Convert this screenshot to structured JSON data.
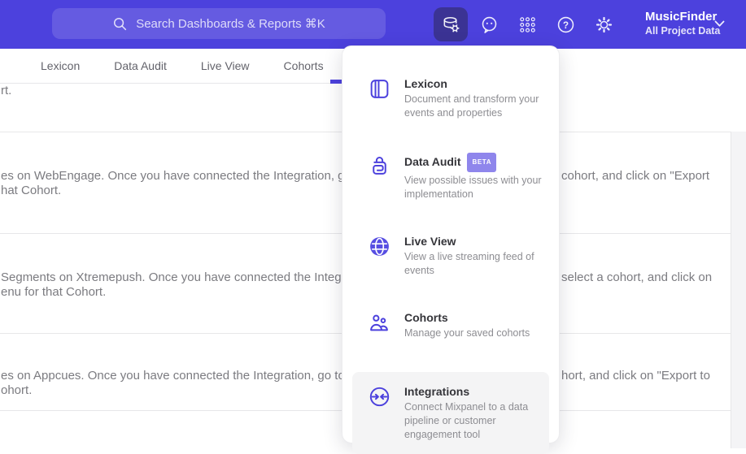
{
  "colors": {
    "topbar_bg": "#4c41dd",
    "accent": "#4c41dd",
    "beta_badge_bg": "#8f86ec",
    "hover_item_bg": "#f4f4f5"
  },
  "topbar": {
    "search_placeholder": "Search Dashboards & Reports ⌘K",
    "icons": [
      "data-management-icon",
      "feedback-smiley-icon",
      "apps-grid-icon",
      "help-icon",
      "settings-gear-icon"
    ],
    "project_name": "MusicFinder",
    "project_subtitle": "All Project Data"
  },
  "tabs": [
    {
      "label": "Lexicon"
    },
    {
      "label": "Data Audit"
    },
    {
      "label": "Live View"
    },
    {
      "label": "Cohorts"
    }
  ],
  "background": {
    "partial_top_text": "rt.",
    "rows": [
      {
        "left_line1": "es on WebEngage. Once you have connected the Integration, go to the",
        "right_line1": "cohort, and click on \"Export",
        "left_line2": "hat Cohort."
      },
      {
        "left_line1": "Segments on Xtremepush. Once you have connected the Integration,",
        "right_line1": "select a cohort, and click on",
        "left_line2": "enu for that Cohort."
      },
      {
        "left_line1": "es on Appcues. Once you have connected the Integration, go to the M",
        "right_line1": "hort, and click on \"Export to",
        "left_line2": "ohort."
      }
    ]
  },
  "menu": {
    "items": [
      {
        "title": "Lexicon",
        "desc": "Document and transform your events and properties",
        "icon": "book-icon"
      },
      {
        "title": "Data Audit",
        "badge": "BETA",
        "desc": "View possible issues with your implementation",
        "icon": "audit-lock-icon"
      },
      {
        "title": "Live View",
        "desc": "View a live streaming feed of events",
        "icon": "globe-icon"
      },
      {
        "title": "Cohorts",
        "desc": "Manage your saved cohorts",
        "icon": "people-icon"
      },
      {
        "title": "Integrations",
        "desc": "Connect Mixpanel to a data pipeline or customer engagement tool",
        "icon": "sync-arrows-icon"
      }
    ]
  }
}
